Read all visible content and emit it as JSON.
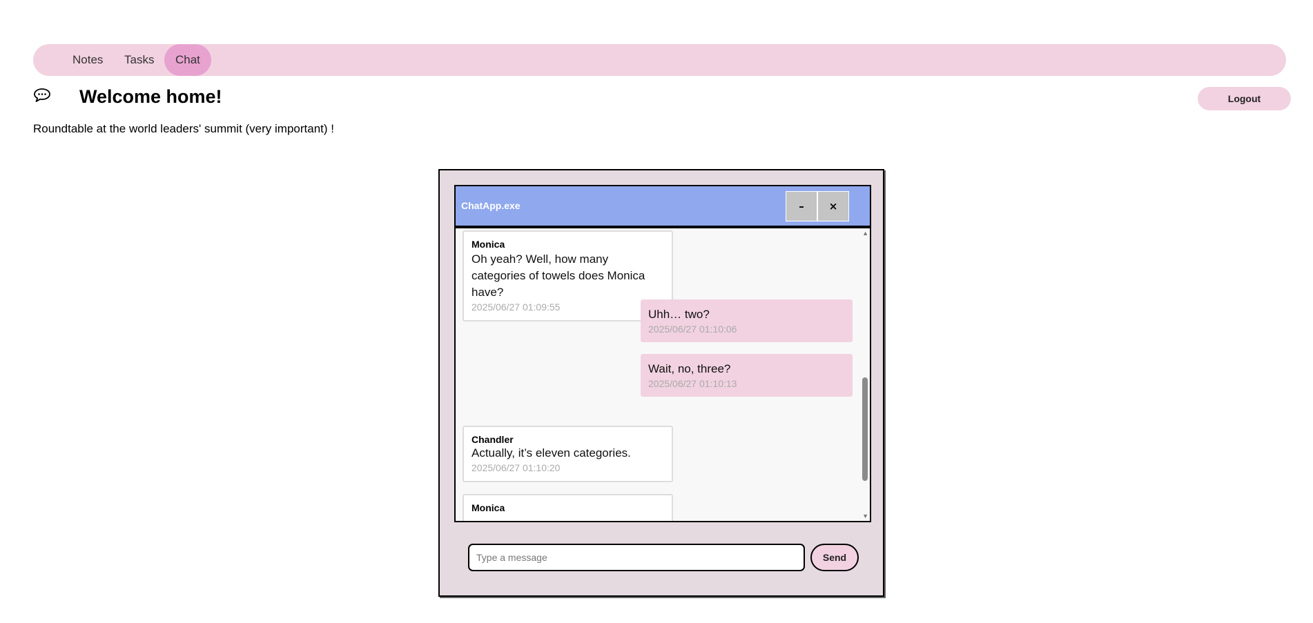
{
  "nav": {
    "items": [
      {
        "label": "Notes"
      },
      {
        "label": "Tasks"
      },
      {
        "label": "Chat",
        "active": true
      }
    ]
  },
  "header": {
    "icon": "chat-bubble-icon",
    "title": "Welcome home!",
    "logout_label": "Logout"
  },
  "subtitle": "Roundtable at the world leaders' summit (very important) !",
  "chat_window": {
    "title": "ChatApp.exe",
    "minimize_label": "–",
    "close_label": "×",
    "messages": [
      {
        "sender": "Monica",
        "text": "Oh yeah? Well, how many categories of towels does Monica have?",
        "time": "2025/06/27 01:09:55"
      },
      {
        "sender": "",
        "text": "Uhh… two?",
        "time": "2025/06/27 01:10:06"
      },
      {
        "sender": "",
        "text": "Wait, no, three?",
        "time": "2025/06/27 01:10:13"
      },
      {
        "sender": "Chandler",
        "text": "Actually, it’s eleven categories.",
        "time": "2025/06/27 01:10:20"
      },
      {
        "sender": "Monica",
        "text": "",
        "time": ""
      }
    ],
    "input_placeholder": "Type a message",
    "send_label": "Send"
  },
  "colors": {
    "nav_bg": "#f2d2e0",
    "nav_active": "#e8a2d0",
    "title_bar": "#8fa8ee",
    "window_bg": "#e4dadf",
    "self_bubble": "#f2d2e0"
  }
}
